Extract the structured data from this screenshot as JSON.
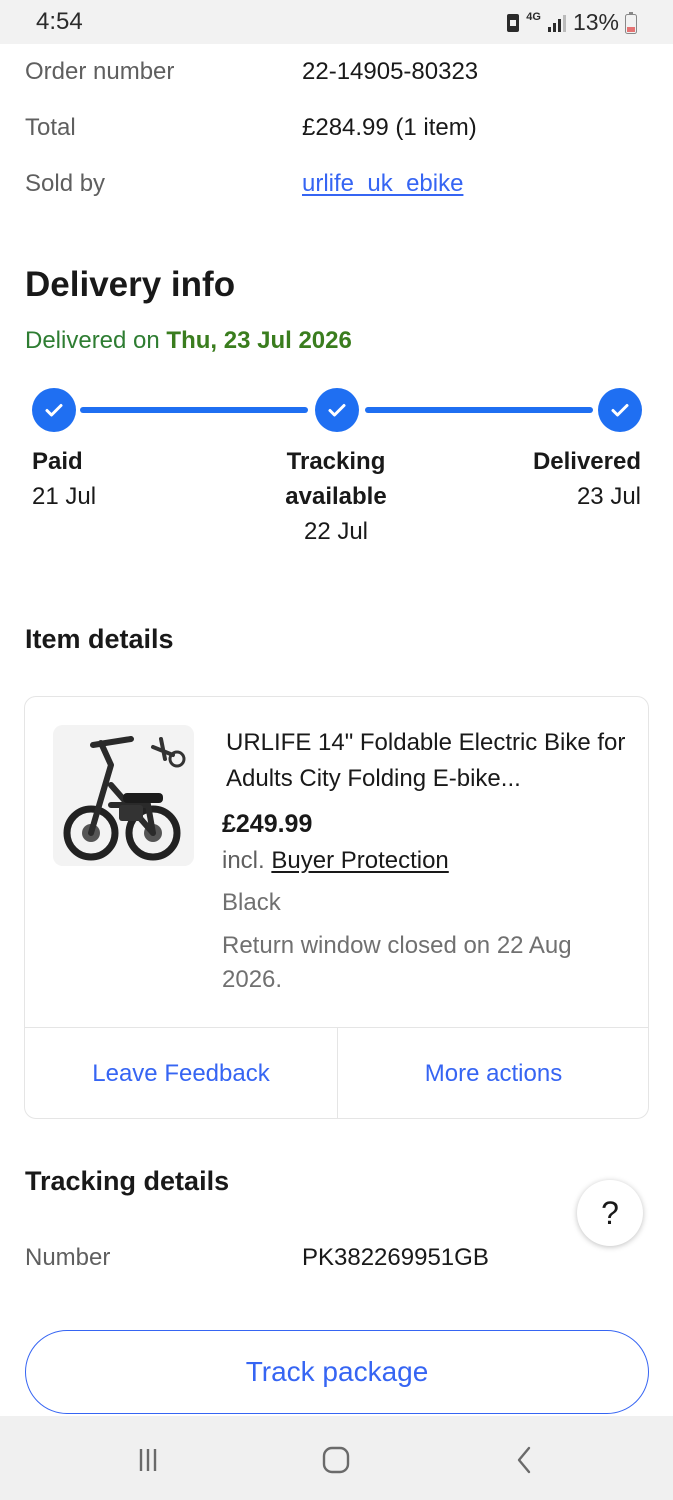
{
  "status_bar": {
    "time": "4:54",
    "network": "4G",
    "battery": "13%"
  },
  "order": {
    "order_number_label": "Order number",
    "order_number": "22-14905-80323",
    "total_label": "Total",
    "total": "£284.99 (1 item)",
    "sold_by_label": "Sold by",
    "seller": "urlife_uk_ebike"
  },
  "delivery": {
    "heading": "Delivery info",
    "delivered_prefix": "Delivered on",
    "delivered_date": "Thu, 23 Jul 2026",
    "steps": [
      {
        "title": "Paid",
        "date": "21 Jul"
      },
      {
        "title_line1": "Tracking",
        "title_line2": "available",
        "date": "22 Jul"
      },
      {
        "title": "Delivered",
        "date": "23 Jul"
      }
    ]
  },
  "item_details": {
    "heading": "Item details",
    "title": "URLIFE 14\" Foldable Electric Bike for Adults City Folding E-bike...",
    "price": "£249.99",
    "protection_prefix": "incl.",
    "protection_link": "Buyer Protection",
    "variant": "Black",
    "return_note": "Return window closed on 22 Aug 2026.",
    "leave_feedback": "Leave Feedback",
    "more_actions": "More actions"
  },
  "tracking": {
    "heading": "Tracking details",
    "number_label": "Number",
    "number": "PK382269951GB",
    "track_button": "Track package",
    "help_label": "?"
  },
  "colors": {
    "accent_blue": "#3665f3",
    "progress_blue": "#1f6ff2",
    "delivered_green": "#2e7d32"
  }
}
